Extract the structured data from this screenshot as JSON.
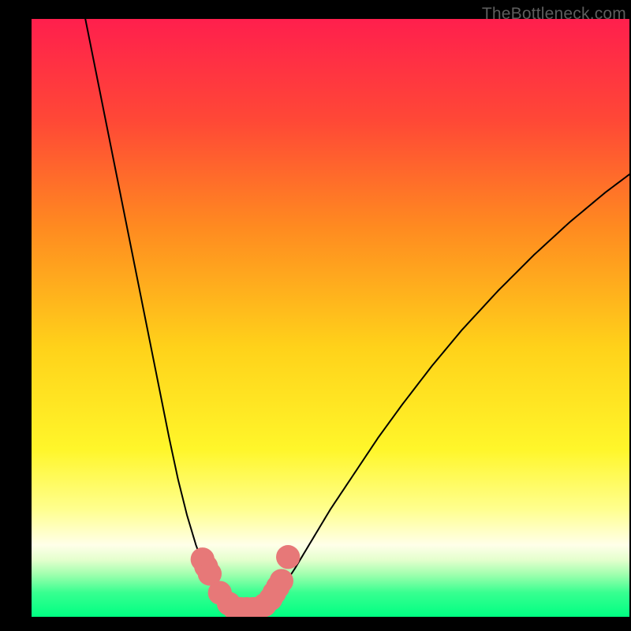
{
  "watermark": "TheBottleneck.com",
  "chart_data": {
    "type": "line",
    "title": "",
    "xlabel": "",
    "ylabel": "",
    "xlim": [
      0,
      100
    ],
    "ylim": [
      0,
      100
    ],
    "background_gradient": {
      "stops": [
        {
          "offset": 0.0,
          "color": "#ff1f4d"
        },
        {
          "offset": 0.17,
          "color": "#ff4836"
        },
        {
          "offset": 0.35,
          "color": "#ff8b20"
        },
        {
          "offset": 0.55,
          "color": "#ffd21a"
        },
        {
          "offset": 0.72,
          "color": "#fff62a"
        },
        {
          "offset": 0.82,
          "color": "#ffff8e"
        },
        {
          "offset": 0.88,
          "color": "#ffffe9"
        },
        {
          "offset": 0.905,
          "color": "#e4ffcd"
        },
        {
          "offset": 0.93,
          "color": "#9dffad"
        },
        {
          "offset": 0.96,
          "color": "#37ff90"
        },
        {
          "offset": 1.0,
          "color": "#00ff82"
        }
      ]
    },
    "series": [
      {
        "name": "left-curve",
        "color": "#000000",
        "x": [
          9.0,
          11.0,
          13.0,
          15.0,
          17.0,
          19.0,
          21.0,
          23.0,
          24.5,
          26.0,
          27.5,
          29.0,
          30.0,
          31.0,
          32.0,
          33.0,
          33.8
        ],
        "y": [
          100,
          90,
          80,
          70,
          60,
          50,
          40,
          30,
          23,
          17,
          12,
          8.0,
          5.5,
          4.0,
          2.8,
          1.8,
          1.3
        ]
      },
      {
        "name": "right-curve",
        "color": "#000000",
        "x": [
          38.5,
          40.0,
          42.0,
          44.0,
          47.0,
          50.0,
          54.0,
          58.0,
          62.0,
          67.0,
          72.0,
          78.0,
          84.0,
          90.0,
          96.0,
          100.0
        ],
        "y": [
          1.3,
          2.5,
          5.0,
          8.0,
          13.0,
          18.0,
          24.0,
          30.0,
          35.5,
          42.0,
          48.0,
          54.5,
          60.5,
          66.0,
          71.0,
          74.0
        ]
      },
      {
        "name": "bottom-flat",
        "color": "#00ff82",
        "x": [
          33.8,
          38.5
        ],
        "y": [
          1.3,
          1.3
        ]
      }
    ],
    "markers": {
      "name": "highlight-dots",
      "color": "#e77878",
      "radius": 2.0,
      "points": [
        {
          "x": 28.6,
          "y": 9.6
        },
        {
          "x": 29.2,
          "y": 8.4
        },
        {
          "x": 29.8,
          "y": 7.2
        },
        {
          "x": 31.5,
          "y": 4.0
        },
        {
          "x": 33.0,
          "y": 2.2
        },
        {
          "x": 34.0,
          "y": 1.4
        },
        {
          "x": 35.0,
          "y": 1.3
        },
        {
          "x": 36.0,
          "y": 1.3
        },
        {
          "x": 37.0,
          "y": 1.3
        },
        {
          "x": 38.0,
          "y": 1.4
        },
        {
          "x": 39.0,
          "y": 2.0
        },
        {
          "x": 40.0,
          "y": 3.0
        },
        {
          "x": 40.6,
          "y": 4.0
        },
        {
          "x": 41.2,
          "y": 5.0
        },
        {
          "x": 41.8,
          "y": 6.0
        },
        {
          "x": 42.9,
          "y": 10.0
        }
      ]
    }
  }
}
